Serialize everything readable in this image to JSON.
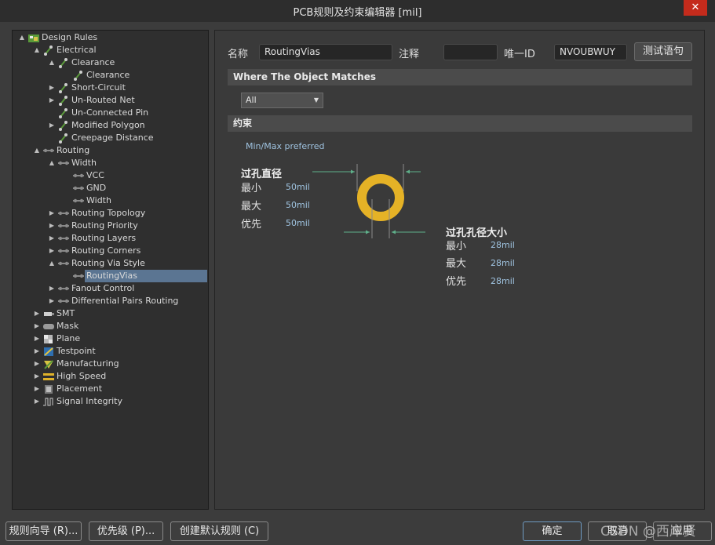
{
  "window": {
    "title": "PCB规则及约束编辑器 [mil]",
    "close_glyph": "✕"
  },
  "tree": {
    "items": [
      {
        "label": "Design Rules",
        "arrow": "▲",
        "icon": "design-rules-icon"
      },
      {
        "label": "Electrical",
        "arrow": "▲",
        "icon": "electrical-icon"
      },
      {
        "label": "Clearance",
        "arrow": "▲",
        "icon": "rule-icon"
      },
      {
        "label": "Clearance",
        "arrow": "",
        "icon": "rule-icon"
      },
      {
        "label": "Short-Circuit",
        "arrow": "▶",
        "icon": "rule-icon"
      },
      {
        "label": "Un-Routed Net",
        "arrow": "▶",
        "icon": "rule-icon"
      },
      {
        "label": "Un-Connected Pin",
        "arrow": "",
        "icon": "rule-icon"
      },
      {
        "label": "Modified Polygon",
        "arrow": "▶",
        "icon": "rule-icon"
      },
      {
        "label": "Creepage Distance",
        "arrow": "",
        "icon": "rule-icon"
      },
      {
        "label": "Routing",
        "arrow": "▲",
        "icon": "routing-icon"
      },
      {
        "label": "Width",
        "arrow": "▲",
        "icon": "routing-icon"
      },
      {
        "label": "VCC",
        "arrow": "",
        "icon": "routing-icon"
      },
      {
        "label": "GND",
        "arrow": "",
        "icon": "routing-icon"
      },
      {
        "label": "Width",
        "arrow": "",
        "icon": "routing-icon"
      },
      {
        "label": "Routing Topology",
        "arrow": "▶",
        "icon": "routing-icon"
      },
      {
        "label": "Routing Priority",
        "arrow": "▶",
        "icon": "routing-icon"
      },
      {
        "label": "Routing Layers",
        "arrow": "▶",
        "icon": "routing-icon"
      },
      {
        "label": "Routing Corners",
        "arrow": "▶",
        "icon": "routing-icon"
      },
      {
        "label": "Routing Via Style",
        "arrow": "▲",
        "icon": "routing-icon"
      },
      {
        "label": "RoutingVias",
        "arrow": "",
        "icon": "routing-icon"
      },
      {
        "label": "Fanout Control",
        "arrow": "▶",
        "icon": "routing-icon"
      },
      {
        "label": "Differential Pairs Routing",
        "arrow": "▶",
        "icon": "routing-icon"
      },
      {
        "label": "SMT",
        "arrow": "▶",
        "icon": "smt-icon"
      },
      {
        "label": "Mask",
        "arrow": "▶",
        "icon": "mask-icon"
      },
      {
        "label": "Plane",
        "arrow": "▶",
        "icon": "plane-icon"
      },
      {
        "label": "Testpoint",
        "arrow": "▶",
        "icon": "testpoint-icon"
      },
      {
        "label": "Manufacturing",
        "arrow": "▶",
        "icon": "manufacturing-icon"
      },
      {
        "label": "High Speed",
        "arrow": "▶",
        "icon": "high-speed-icon"
      },
      {
        "label": "Placement",
        "arrow": "▶",
        "icon": "placement-icon"
      },
      {
        "label": "Signal Integrity",
        "arrow": "▶",
        "icon": "signal-integrity-icon"
      }
    ]
  },
  "form": {
    "name_label": "名称",
    "name_value": "RoutingVias",
    "comment_label": "注释",
    "comment_value": "",
    "uid_label": "唯一ID",
    "uid_value": "NVOUBWUY",
    "test_button": "测试语句"
  },
  "where": {
    "title": "Where The Object Matches",
    "selected": "All"
  },
  "constraints": {
    "title": "约束",
    "mode": "Min/Max preferred",
    "via_diameter": {
      "title": "过孔直径",
      "rows": [
        {
          "label": "最小",
          "value": "50mil"
        },
        {
          "label": "最大",
          "value": "50mil"
        },
        {
          "label": "优先",
          "value": "50mil"
        }
      ]
    },
    "hole_size": {
      "title": "过孔孔径大小",
      "rows": [
        {
          "label": "最小",
          "value": "28mil"
        },
        {
          "label": "最大",
          "value": "28mil"
        },
        {
          "label": "优先",
          "value": "28mil"
        }
      ]
    }
  },
  "colors": {
    "via_ring": "#e5b226",
    "via_hole": "#3a3a3a",
    "dim_line": "#5fb08a",
    "selection": "#5b7592"
  },
  "buttons": {
    "rule_wizard": "规则向导 (R)...",
    "priorities": "优先级 (P)...",
    "create_default": "创建默认规则 (C)",
    "ok": "确定",
    "cancel": "取消",
    "apply": "应用"
  },
  "watermark": "CSDN @西岸贤"
}
